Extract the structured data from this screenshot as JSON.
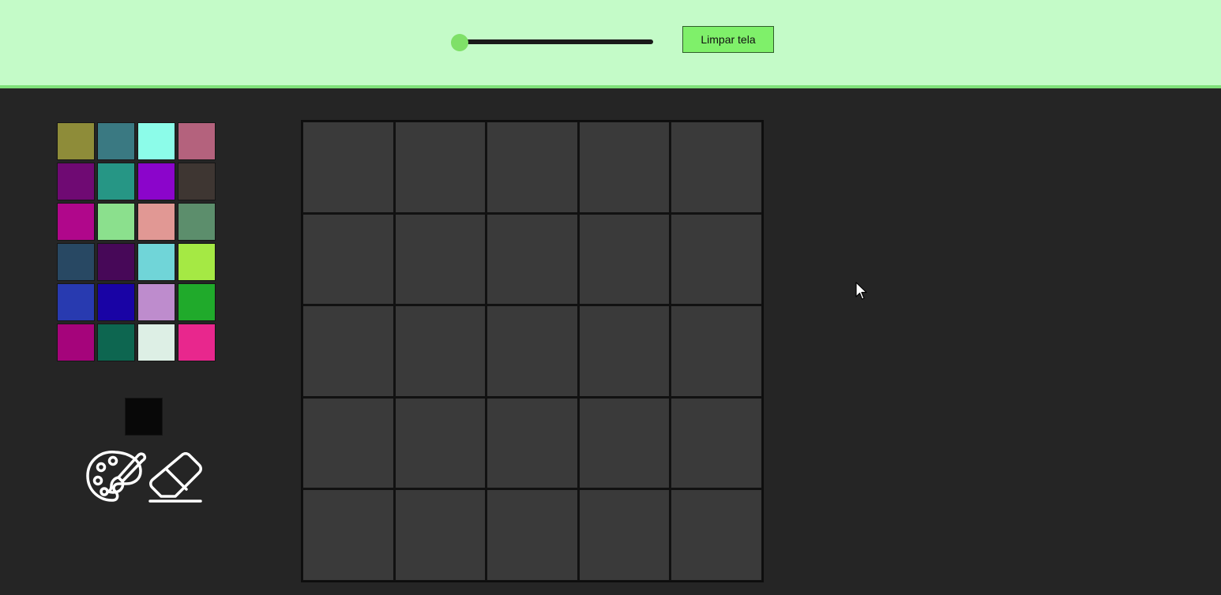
{
  "toolbar": {
    "size_slider": {
      "min": 0,
      "max": 1,
      "value": 0.0
    },
    "clear_button_label": "Limpar tela"
  },
  "palette": {
    "colors": [
      "#8e8c39",
      "#3a7982",
      "#8cfce9",
      "#b4627d",
      "#6f0a73",
      "#269685",
      "#8b05cb",
      "#3e3632",
      "#b0078b",
      "#8be08d",
      "#e19894",
      "#5c8e6c",
      "#284863",
      "#470858",
      "#70d5d8",
      "#a5e944",
      "#283ab0",
      "#1903a5",
      "#be8ccd",
      "#20aa2b",
      "#a5047b",
      "#0d6650",
      "#ddefe5",
      "#e8278d"
    ],
    "current_color": "#080808"
  },
  "tools": {
    "palette_icon": "paint-palette-icon",
    "eraser_icon": "eraser-icon"
  },
  "board": {
    "rows": 5,
    "cols": 5,
    "cell_color": "#3a3a3a"
  }
}
